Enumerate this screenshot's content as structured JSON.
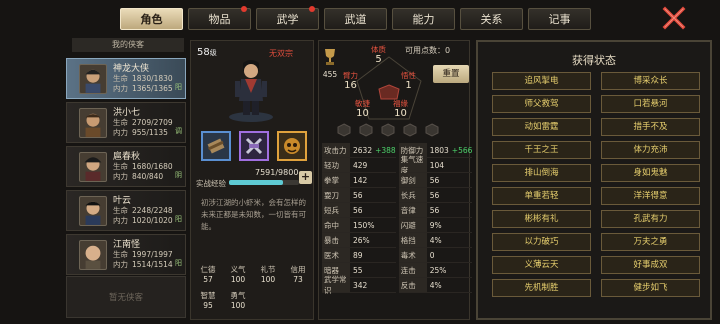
{
  "tabs": [
    {
      "label": "角色",
      "active": true,
      "badge": false
    },
    {
      "label": "物品",
      "active": false,
      "badge": true
    },
    {
      "label": "武学",
      "active": false,
      "badge": true
    },
    {
      "label": "武道",
      "active": false,
      "badge": false
    },
    {
      "label": "能力",
      "active": false,
      "badge": false
    },
    {
      "label": "关系",
      "active": false,
      "badge": false
    },
    {
      "label": "记事",
      "active": false,
      "badge": false
    }
  ],
  "hero_list": {
    "header": "我的侠客",
    "empty_label": "暂无侠客",
    "heroes": [
      {
        "name": "神龙大侠",
        "hp_label": "生命",
        "hp": "1830/1830",
        "mp_label": "内力",
        "mp": "1365/1365",
        "tag": "阳"
      },
      {
        "name": "洪小七",
        "hp_label": "生命",
        "hp": "2709/2709",
        "mp_label": "内力",
        "mp": "955/1135",
        "tag": "调"
      },
      {
        "name": "扈春秋",
        "hp_label": "生命",
        "hp": "1680/1680",
        "mp_label": "内力",
        "mp": "840/840",
        "tag": "阴"
      },
      {
        "name": "叶云",
        "hp_label": "生命",
        "hp": "2248/2248",
        "mp_label": "内力",
        "mp": "1020/1020",
        "tag": "阳"
      },
      {
        "name": "江南怪",
        "hp_label": "生命",
        "hp": "1997/1997",
        "mp_label": "内力",
        "mp": "1514/1514",
        "tag": "阳"
      }
    ]
  },
  "profile": {
    "level": "58",
    "level_unit": "级",
    "sect": "无双宗",
    "exp_label": "实战经验",
    "exp_text": "7591/9800",
    "exp_fraction": 0.775,
    "plus": "+",
    "bio": "初涉江湖的小虾米，会有怎样的未来正都是未知数，一切皆有可能。",
    "traits": [
      {
        "label": "仁德",
        "value": "57"
      },
      {
        "label": "义气",
        "value": "100"
      },
      {
        "label": "礼节",
        "value": "100"
      },
      {
        "label": "信用",
        "value": "73"
      },
      {
        "label": "智慧",
        "value": "95"
      },
      {
        "label": "勇气",
        "value": "100"
      }
    ]
  },
  "attributes": {
    "points_label": "可用点数：",
    "points": "0",
    "potential": "455",
    "reset_label": "重置",
    "constitution": {
      "label": "体质",
      "value": "5"
    },
    "strength": {
      "label": "臂力",
      "value": "16"
    },
    "insight": {
      "label": "悟性",
      "value": "1"
    },
    "agility": {
      "label": "敏捷",
      "value": "10"
    },
    "fortune": {
      "label": "福缘",
      "value": "10"
    },
    "stats": [
      {
        "label": "攻击力",
        "value": "2632",
        "bonus": "+388"
      },
      {
        "label": "防御力",
        "value": "1803",
        "bonus": "+566"
      },
      {
        "label": "轻功",
        "value": "429",
        "bonus": ""
      },
      {
        "label": "集气速度",
        "value": "104",
        "bonus": ""
      },
      {
        "label": "拳掌",
        "value": "142",
        "bonus": ""
      },
      {
        "label": "御剑",
        "value": "56",
        "bonus": ""
      },
      {
        "label": "耍刀",
        "value": "56",
        "bonus": ""
      },
      {
        "label": "长兵",
        "value": "56",
        "bonus": ""
      },
      {
        "label": "短兵",
        "value": "56",
        "bonus": ""
      },
      {
        "label": "音律",
        "value": "56",
        "bonus": ""
      },
      {
        "label": "命中",
        "value": "150%",
        "bonus": ""
      },
      {
        "label": "闪避",
        "value": "9%",
        "bonus": ""
      },
      {
        "label": "暴击",
        "value": "26%",
        "bonus": ""
      },
      {
        "label": "格挡",
        "value": "4%",
        "bonus": ""
      },
      {
        "label": "医术",
        "value": "89",
        "bonus": ""
      },
      {
        "label": "毒术",
        "value": "0",
        "bonus": ""
      },
      {
        "label": "暗器",
        "value": "55",
        "bonus": ""
      },
      {
        "label": "连击",
        "value": "25%",
        "bonus": ""
      },
      {
        "label": "武学常识",
        "value": "342",
        "bonus": ""
      },
      {
        "label": "反击",
        "value": "4%",
        "bonus": ""
      }
    ]
  },
  "status": {
    "title": "获得状态",
    "items": [
      "追风掣电",
      "博采众长",
      "师父救驾",
      "口若悬河",
      "动如雷霆",
      "措手不及",
      "千王之王",
      "体力充沛",
      "排山倒海",
      "身如鬼魅",
      "单重若轻",
      "洋洋得意",
      "彬彬有礼",
      "孔武有力",
      "以力破巧",
      "万夫之勇",
      "义薄云天",
      "好事成双",
      "先机制胜",
      "健步如飞"
    ]
  },
  "colors": {
    "accent_gold": "#e7cf6e",
    "bonus_green": "#4cd16a",
    "attr_red": "#e4523f",
    "exp_cyan": "#5ecad3"
  }
}
